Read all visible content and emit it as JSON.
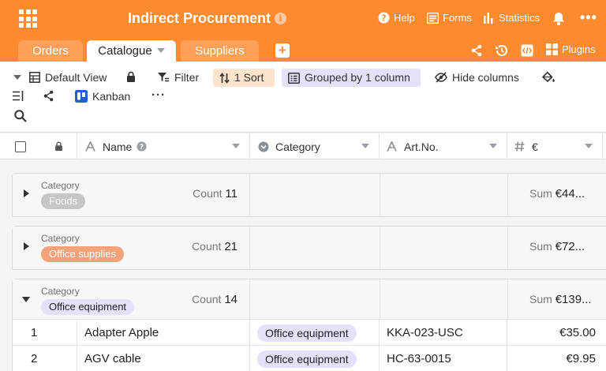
{
  "header": {
    "title": "Indirect Procurement",
    "info_icon": "info-icon",
    "help_label": "Help",
    "forms_label": "Forms",
    "statistics_label": "Statistics",
    "bell_icon": "bell-icon",
    "more_icon": "kebab-icon",
    "bg_color": "#ff8a2f"
  },
  "tabs": [
    {
      "label": "Orders"
    },
    {
      "label": "Catalogue",
      "active": true
    },
    {
      "label": "Suppliers"
    }
  ],
  "tab_actions": {
    "plugins_label": "Plugins"
  },
  "toolbar": {
    "view_label": "Default View",
    "filter_label": "Filter",
    "sort_label": "1 Sort",
    "group_label": "Grouped by 1 column",
    "hide_label": "Hide columns",
    "kanban_label": "Kanban",
    "sort_color": "#fde4cc",
    "group_color": "#e6e1fb"
  },
  "columns": [
    {
      "label": "Name",
      "type": "text"
    },
    {
      "label": "Category",
      "type": "single-select"
    },
    {
      "label": "Art.No.",
      "type": "text"
    },
    {
      "label": "€",
      "type": "number"
    }
  ],
  "groups": [
    {
      "field": "Category",
      "value": "Foods",
      "count_label": "Count",
      "count": "11",
      "sum_label": "Sum",
      "sum": "€44...",
      "pill_color": "#c6c6c6",
      "pill_text_color": "#ffffff",
      "expanded": false
    },
    {
      "field": "Category",
      "value": "Office supplies",
      "count_label": "Count",
      "count": "21",
      "sum_label": "Sum",
      "sum": "€72...",
      "pill_color": "#f3a27a",
      "pill_text_color": "#ffffff",
      "expanded": false
    },
    {
      "field": "Category",
      "value": "Office equipment",
      "count_label": "Count",
      "count": "14",
      "sum_label": "Sum",
      "sum": "€139...",
      "pill_color": "#e6e1fb",
      "pill_text_color": "#222222",
      "expanded": true
    }
  ],
  "rows": [
    {
      "index": "1",
      "name": "Adapter Apple",
      "category": "Office equipment",
      "art_no": "KKA-023-USC",
      "price": "€35.00"
    },
    {
      "index": "2",
      "name": "AGV cable",
      "category": "Office equipment",
      "art_no": "HC-63-0015",
      "price": "€9.95"
    }
  ]
}
